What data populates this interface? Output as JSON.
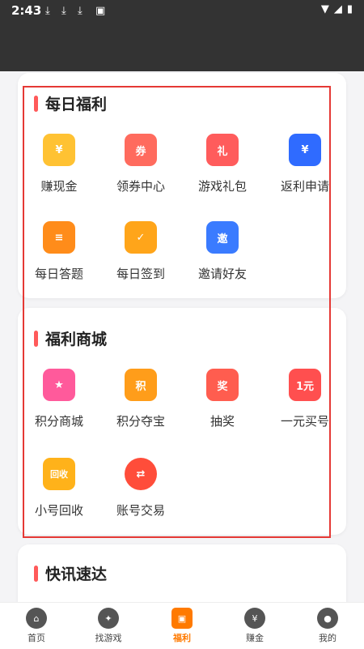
{
  "status": {
    "time": "2:43"
  },
  "sections": [
    {
      "title": "每日福利",
      "items": [
        {
          "label": "赚现金",
          "icon": "cash-ticket-icon",
          "color": "#ffc233",
          "glyph": "¥"
        },
        {
          "label": "领券中心",
          "icon": "coupon-icon",
          "color": "#ff6b5e",
          "glyph": "券"
        },
        {
          "label": "游戏礼包",
          "icon": "gift-pack-icon",
          "color": "#ff5c5c",
          "glyph": "礼"
        },
        {
          "label": "返利申请",
          "icon": "rebate-wallet-icon",
          "color": "#2f6bff",
          "glyph": "¥"
        },
        {
          "label": "每日答题",
          "icon": "quiz-icon",
          "color": "#ff8c1a",
          "glyph": "≡"
        },
        {
          "label": "每日签到",
          "icon": "checkin-calendar-icon",
          "color": "#ffa51a",
          "glyph": "✓"
        },
        {
          "label": "邀请好友",
          "icon": "invite-icon",
          "color": "#3a7bff",
          "glyph": "邀"
        }
      ]
    },
    {
      "title": "福利商城",
      "items": [
        {
          "label": "积分商城",
          "icon": "points-mall-bag-icon",
          "color": "#ff5a9b",
          "glyph": "★"
        },
        {
          "label": "积分夺宝",
          "icon": "points-treasure-icon",
          "color": "#ff9d1a",
          "glyph": "积"
        },
        {
          "label": "抽奖",
          "icon": "lottery-icon",
          "color": "#ff5d4f",
          "glyph": "奖"
        },
        {
          "label": "一元买号",
          "icon": "one-yuan-icon",
          "color": "#ff4f4f",
          "glyph": "1元"
        },
        {
          "label": "小号回收",
          "icon": "recycle-icon",
          "color": "#ffb21a",
          "glyph": "回收"
        },
        {
          "label": "账号交易",
          "icon": "account-trade-icon",
          "color": "#ff4d3a",
          "glyph": "⇄"
        }
      ]
    },
    {
      "title": "快讯速达",
      "items": []
    }
  ],
  "nav": [
    {
      "label": "首页",
      "icon": "home-icon",
      "glyph": "⌂"
    },
    {
      "label": "找游戏",
      "icon": "compass-icon",
      "glyph": "✦"
    },
    {
      "label": "福利",
      "icon": "gift-icon",
      "glyph": "▣",
      "active": true
    },
    {
      "label": "赚金",
      "icon": "money-bag-icon",
      "glyph": "¥"
    },
    {
      "label": "我的",
      "icon": "user-icon",
      "glyph": "●"
    }
  ]
}
